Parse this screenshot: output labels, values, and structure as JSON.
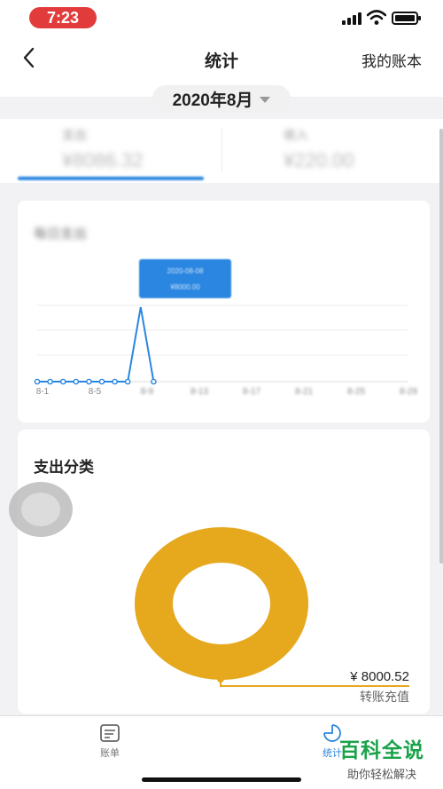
{
  "status_bar": {
    "time": "7:23",
    "icons": [
      "signal-icon",
      "wifi-icon",
      "battery-icon"
    ]
  },
  "nav": {
    "back_icon": "chevron-left-icon",
    "title": "统计",
    "right_link": "我的账本"
  },
  "month_picker": {
    "label": "2020年8月",
    "caret_icon": "caret-down-icon"
  },
  "summary": {
    "expense_label": "支出",
    "expense_amount": "¥8086.32",
    "income_label": "收入",
    "income_amount": "¥220.00",
    "active_tab_color": "#2a86e0"
  },
  "daily_chart": {
    "title": "每日支出",
    "tooltip": [
      "2020-08-08",
      "¥8000.00"
    ]
  },
  "chart_data": {
    "type": "line",
    "x_ticks": [
      "8-1",
      "8-5",
      "8-9",
      "8-13",
      "8-17",
      "8-21",
      "8-25",
      "8-29"
    ],
    "x": [
      1,
      2,
      3,
      4,
      5,
      6,
      7,
      8,
      9,
      10
    ],
    "values": [
      0,
      0,
      0,
      0,
      0,
      0,
      0,
      0,
      8000,
      0
    ],
    "color": "#2a86e0"
  },
  "category": {
    "title": "支出分类",
    "slice_amount": "¥ 8000.52",
    "slice_label": "转账充值",
    "slice_color": "#e6a81d"
  },
  "tab_bar": {
    "items": [
      {
        "label": "账单",
        "icon": "bill-icon"
      },
      {
        "label": "统计",
        "icon": "pie-chart-icon"
      }
    ]
  },
  "watermark": {
    "main": "百科全说",
    "sub": "助你轻松解决"
  }
}
